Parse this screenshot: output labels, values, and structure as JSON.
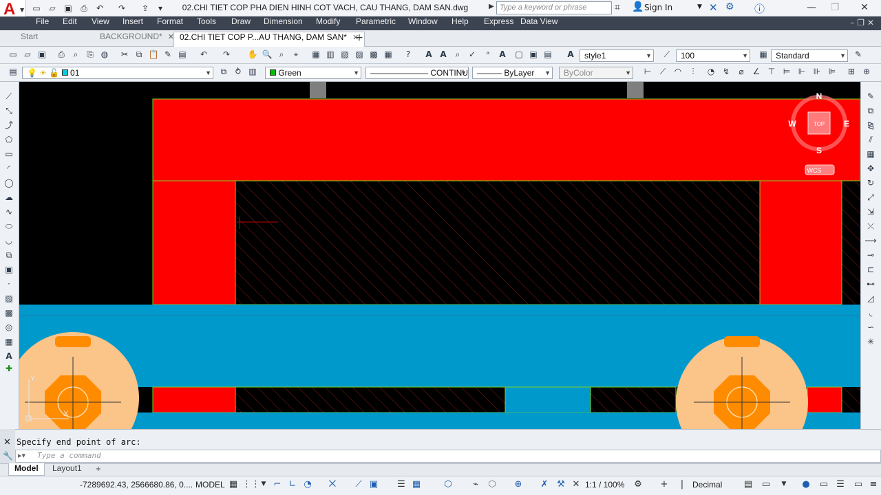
{
  "title": {
    "app_letter": "A",
    "document": "02.CHI TIET COP PHA DIEN HINH COT VACH, CAU THANG, DAM SAN.dwg",
    "search_placeholder": "Type a keyword or phrase",
    "sign_in": "Sign In"
  },
  "menu": [
    "File",
    "Edit",
    "View",
    "Insert",
    "Format",
    "Tools",
    "Draw",
    "Dimension",
    "Modify",
    "Parametric",
    "Window",
    "Help",
    "Express",
    "Data View"
  ],
  "tabs": [
    {
      "label": "Start",
      "active": false
    },
    {
      "label": "BACKGROUND*",
      "active": false
    },
    {
      "label": "02.CHI TIET COP P...AU THANG, DAM SAN*",
      "active": true
    }
  ],
  "toolbar1": {
    "text_style": "style1",
    "dim_scale": "100",
    "table_style": "Standard"
  },
  "toolbar2": {
    "layer": "01",
    "color": "Green",
    "linetype": "CONTINUOUS",
    "lineweight": "ByLayer",
    "plotstyle": "ByColor"
  },
  "viewcube": {
    "top": "TOP",
    "n": "N",
    "s": "S",
    "e": "E",
    "w": "W",
    "wcs": "WCS"
  },
  "ucs": {
    "y": "Y",
    "x": "X"
  },
  "command": {
    "history": "Specify end point of arc:",
    "placeholder": "Type a command"
  },
  "layout_tabs": [
    "Model",
    "Layout1"
  ],
  "status": {
    "coords": "-7289692.43, 2566680.86, 0....",
    "space": "MODEL",
    "annoscale": "1:1 / 100%",
    "units": "Decimal"
  },
  "colors": {
    "red": "#ff0000",
    "blue": "#0099cc",
    "orange": "#fbc488",
    "dark_orange": "#ff8c00",
    "hatch": "#8b1a1a",
    "green_line": "#7dd321"
  }
}
